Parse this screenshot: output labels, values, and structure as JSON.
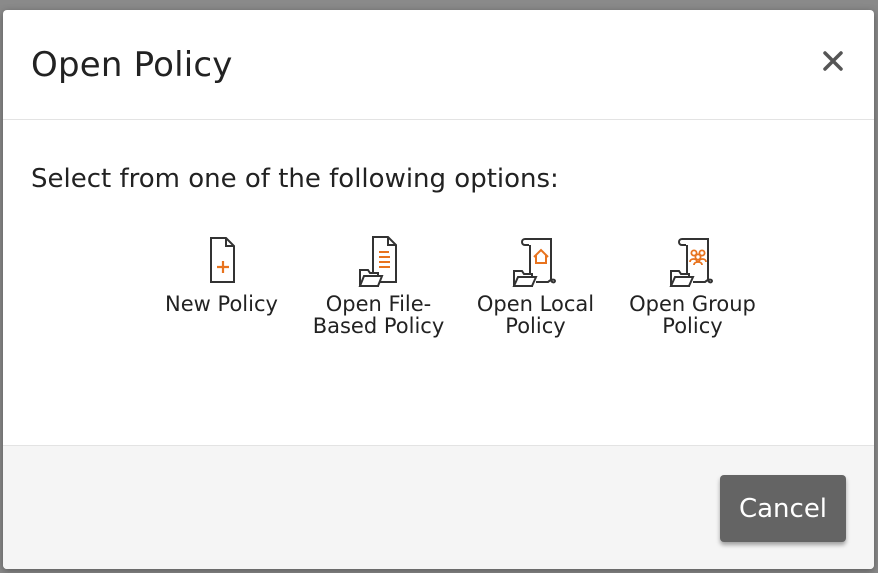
{
  "dialog": {
    "title": "Open Policy",
    "close_label": "×",
    "prompt": "Select from one of the following options:",
    "options": [
      {
        "label": "New Policy",
        "icon": "new-policy-icon"
      },
      {
        "label": "Open File-Based Policy",
        "icon": "file-based-policy-icon"
      },
      {
        "label": "Open Local Policy",
        "icon": "local-policy-icon"
      },
      {
        "label": "Open Group Policy",
        "icon": "group-policy-icon"
      }
    ],
    "cancel_label": "Cancel"
  },
  "colors": {
    "accent": "#e8731e",
    "icon_stroke": "#333333",
    "cancel_button": "#646464"
  }
}
